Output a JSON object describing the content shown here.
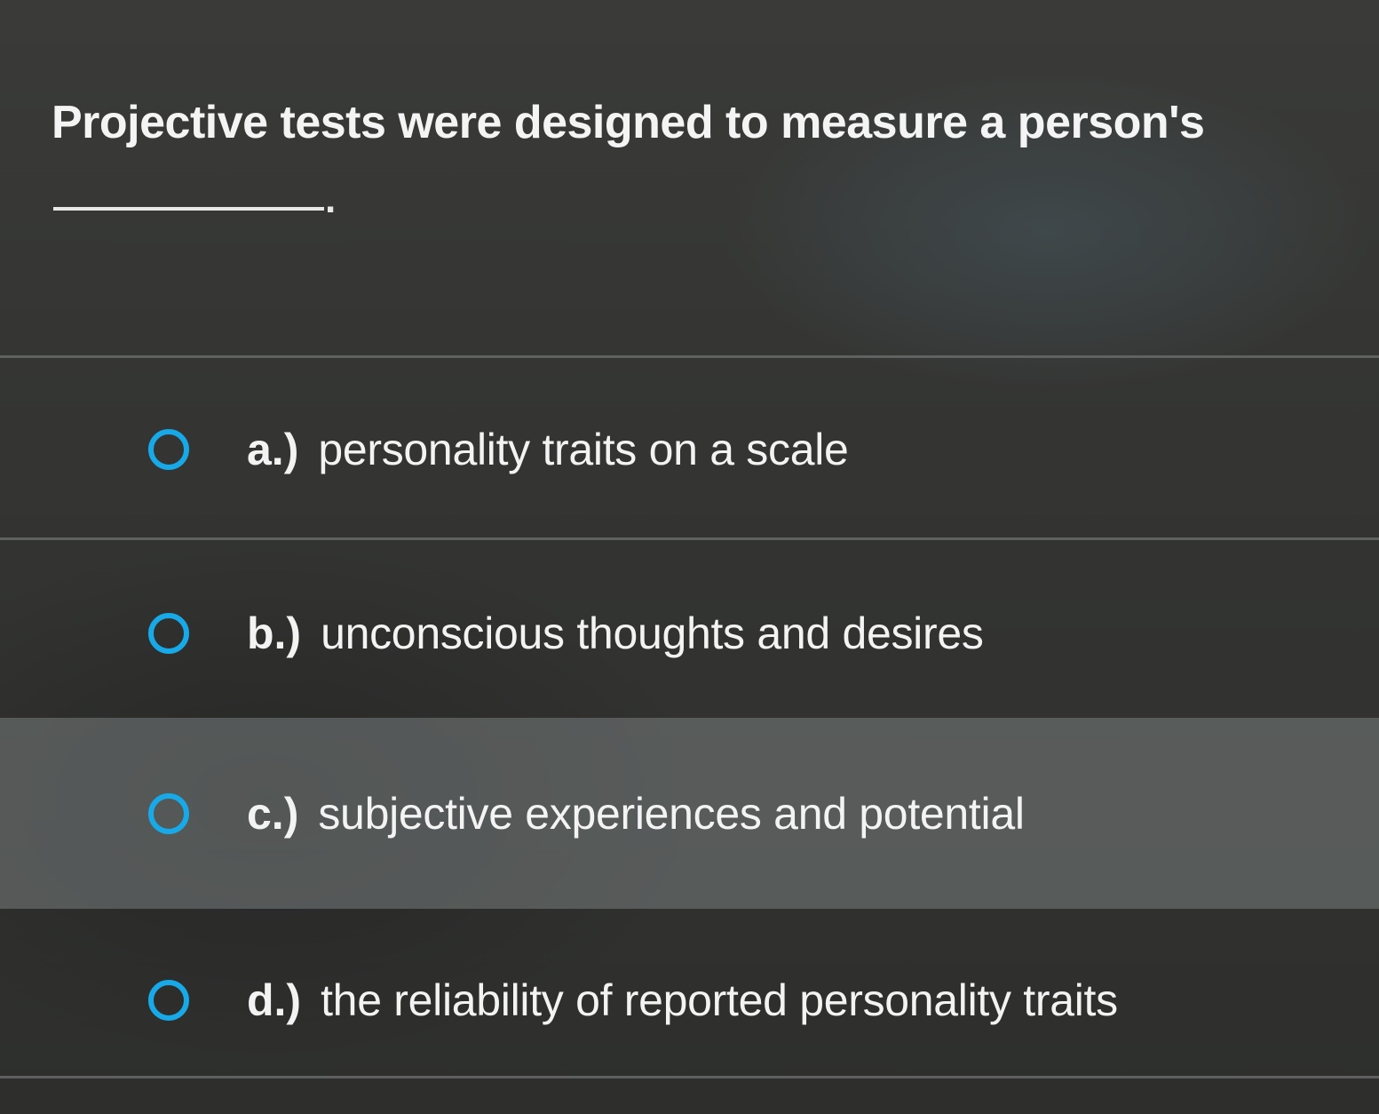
{
  "question": {
    "text": "Projective tests were designed to measure a person's",
    "blank_suffix": "."
  },
  "options": [
    {
      "letter": "a.)",
      "text": "personality traits on a scale",
      "selected": false
    },
    {
      "letter": "b.)",
      "text": "unconscious thoughts and desires",
      "selected": false
    },
    {
      "letter": "c.)",
      "text": "subjective experiences and potential",
      "selected": false
    },
    {
      "letter": "d.)",
      "text": "the reliability of reported personality traits",
      "selected": false
    }
  ],
  "colors": {
    "background": "#2f312f",
    "text": "#f3f3f3",
    "radio_accent": "#17a9e8",
    "highlight_row": "#6b7070"
  }
}
